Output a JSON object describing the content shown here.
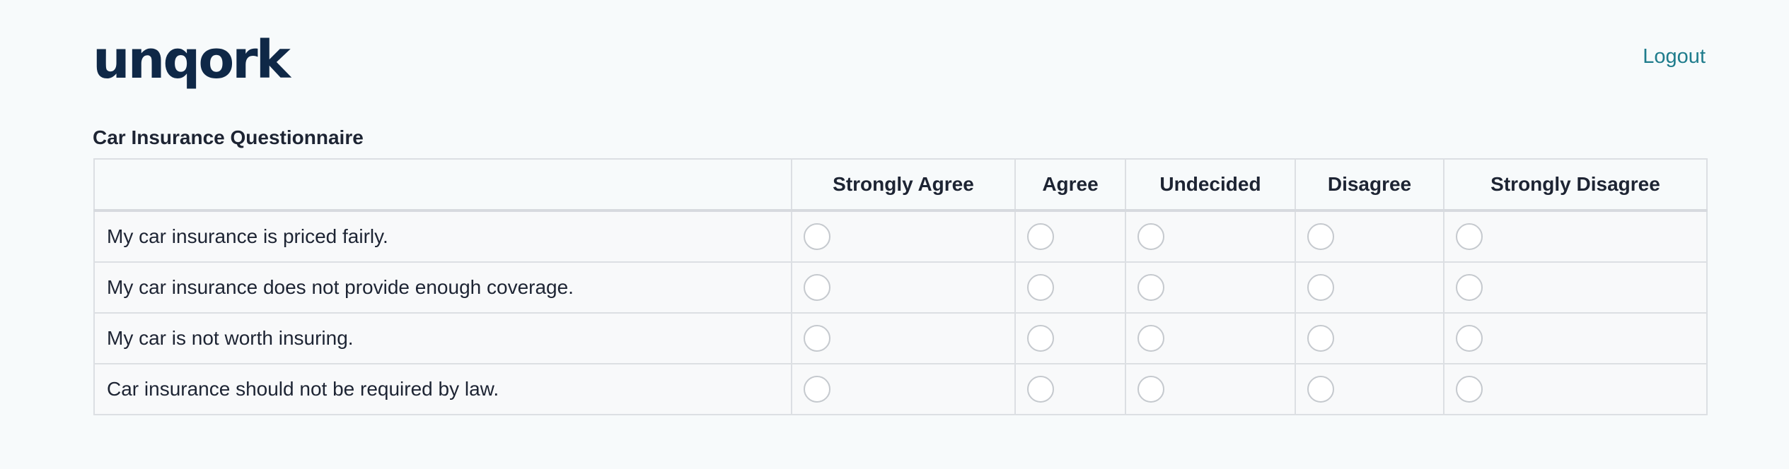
{
  "header": {
    "logo_text": "unqork",
    "logout_label": "Logout"
  },
  "form": {
    "title": "Car Insurance Questionnaire",
    "columns": [
      "",
      "Strongly Agree",
      "Agree",
      "Undecided",
      "Disagree",
      "Strongly Disagree"
    ],
    "questions": [
      "My car insurance is priced fairly.",
      "My car insurance does not provide enough coverage.",
      "My car is not worth insuring.",
      "Car insurance should not be required by law."
    ]
  },
  "colors": {
    "background": "#f7fafb",
    "logo": "#0f2847",
    "link": "#1f7c8c",
    "border": "#dcdfe3"
  }
}
